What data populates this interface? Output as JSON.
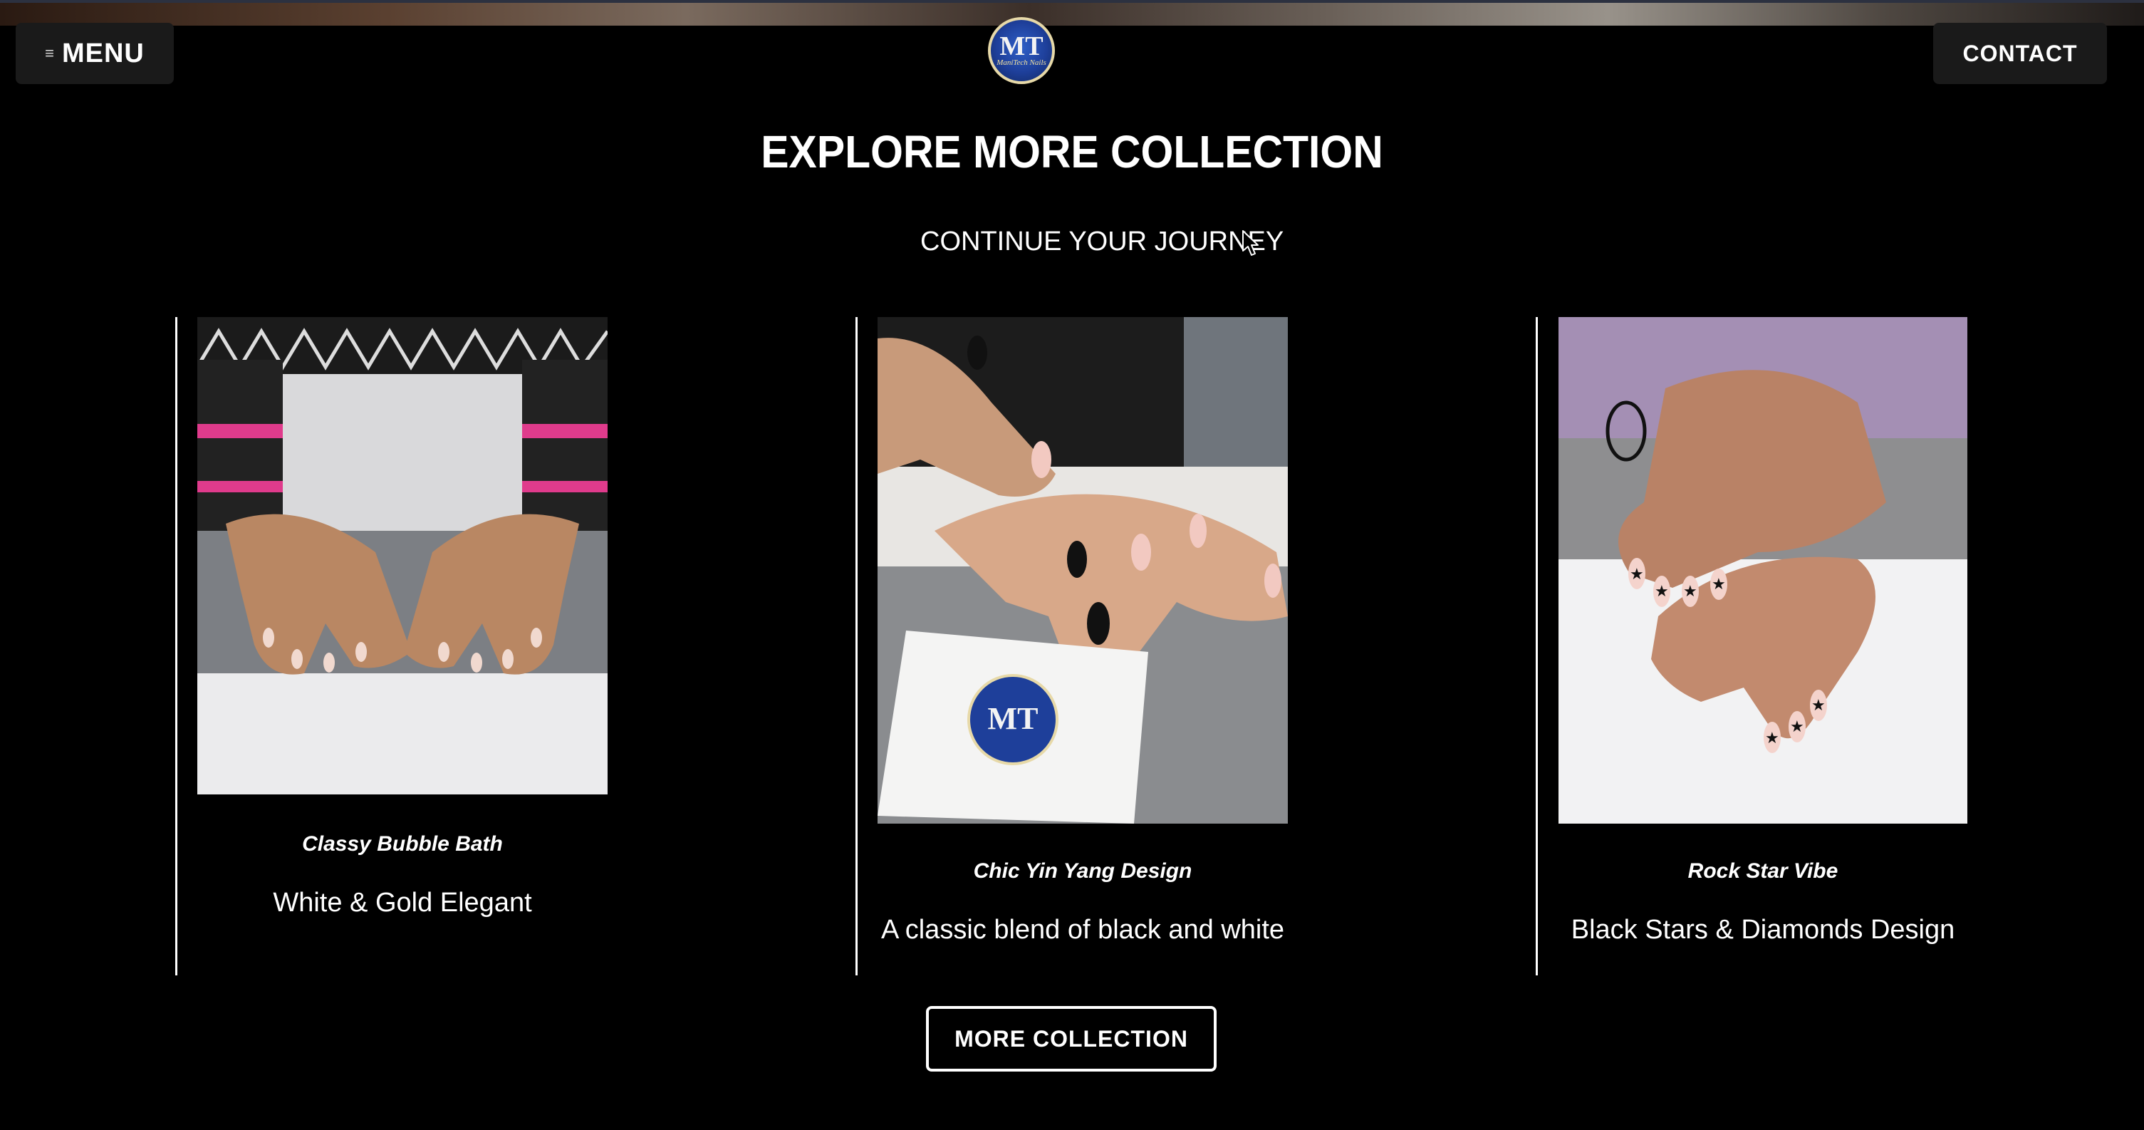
{
  "header": {
    "menu_label": "MENU",
    "contact_label": "CONTACT",
    "logo": {
      "monogram": "MT",
      "script": "ManiTech Nails"
    }
  },
  "section": {
    "title": "EXPLORE MORE COLLECTION",
    "subtitle": "CONTINUE YOUR JOURNEY"
  },
  "cards": [
    {
      "name": "Classy Bubble Bath",
      "description": "White & Gold Elegant",
      "image_icon": "hands-nails-photo"
    },
    {
      "name": "Chic Yin Yang Design",
      "description": "A classic blend of black and white",
      "image_icon": "hands-nails-photo"
    },
    {
      "name": "Rock Star Vibe",
      "description": "Black Stars & Diamonds Design",
      "image_icon": "hands-nails-photo"
    }
  ],
  "more_button_label": "MORE COLLECTION",
  "colors": {
    "background": "#000000",
    "text": "#ffffff",
    "button_bg": "#1a1a1a"
  }
}
